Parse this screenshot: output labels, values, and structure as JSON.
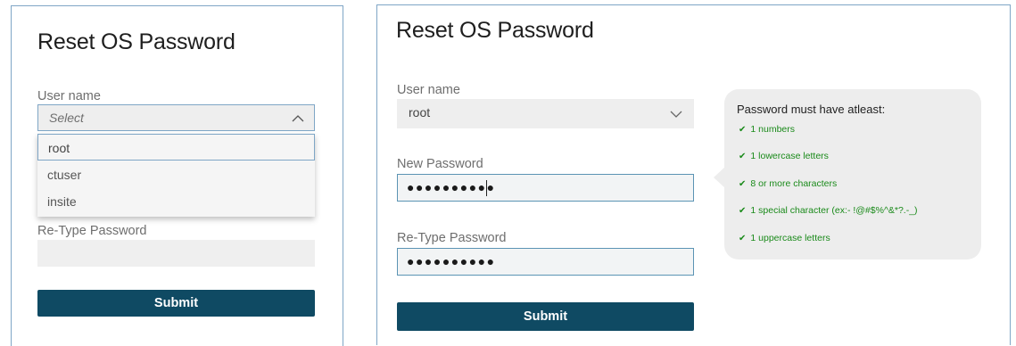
{
  "left": {
    "title": "Reset OS Password",
    "user_name_label": "User name",
    "select_placeholder": "Select",
    "options": [
      "root",
      "ctuser",
      "insite"
    ],
    "retype_label": "Re-Type Password",
    "submit_label": "Submit"
  },
  "right": {
    "title": "Reset OS Password",
    "user_name_label": "User name",
    "user_name_value": "root",
    "new_password_label": "New Password",
    "new_password_value": "●●●●●●●●●●",
    "retype_label": "Re-Type Password",
    "retype_value": "●●●●●●●●●●",
    "submit_label": "Submit"
  },
  "tooltip": {
    "title": "Password must have atleast:",
    "check_glyph": "✔",
    "rules": [
      "1 numbers",
      "1 lowercase letters",
      "8 or more characters",
      "1 special character (ex:- !@#$%^&*?.-_)",
      "1 uppercase letters"
    ]
  },
  "colors": {
    "button": "#0f4a63",
    "focus_border": "#5b94b4",
    "rule_text": "#1a8a1a",
    "field_bg": "#efefef"
  },
  "icons": {
    "dropdown_open": "chevron-up-icon",
    "dropdown_closed": "chevron-down-icon",
    "rule_check": "check-icon"
  }
}
